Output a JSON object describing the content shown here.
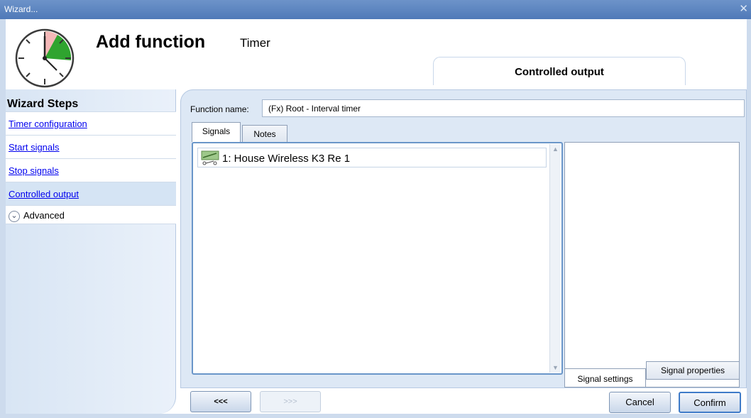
{
  "window": {
    "title": "Wizard...",
    "close_glyph": "✕"
  },
  "header": {
    "heading": "Add function",
    "function_type": "Timer",
    "current_step": "Controlled output"
  },
  "sidebar": {
    "title": "Wizard Steps",
    "steps": [
      {
        "label": "Timer configuration"
      },
      {
        "label": "Start signals"
      },
      {
        "label": "Stop signals"
      },
      {
        "label": "Controlled output",
        "active": true
      }
    ],
    "advanced": {
      "label": "Advanced",
      "chevron": "⌄"
    }
  },
  "main": {
    "function_name_label": "Function name:",
    "function_name_value": "(Fx) Root - Interval timer",
    "tabs": [
      {
        "label": "Signals"
      },
      {
        "label": "Notes"
      }
    ],
    "signals": [
      {
        "label": "1: House Wireless K3 Re 1",
        "icon": "relay-output-icon"
      }
    ],
    "scroll_up": "▲",
    "scroll_down": "▼",
    "side_tabs": [
      {
        "label": "Signal settings"
      },
      {
        "label": "Signal properties"
      }
    ]
  },
  "footer": {
    "prev_label": "<<<",
    "next_label": ">>>",
    "cancel_label": "Cancel",
    "confirm_label": "Confirm"
  },
  "colors": {
    "accent": "#4f79b8",
    "panel": "#dde8f5",
    "link": "#0000ee",
    "selection_border": "#6a96c9"
  }
}
